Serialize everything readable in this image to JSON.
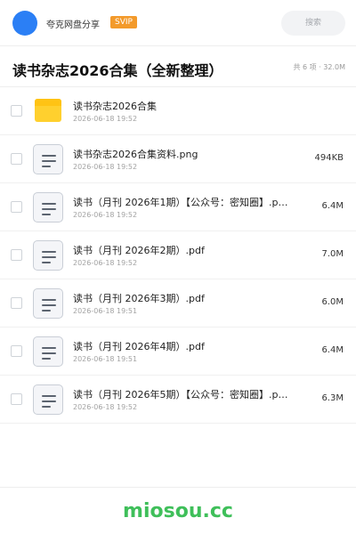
{
  "header": {
    "share_name": "夸克网盘分享",
    "badge": "SVIP",
    "search_placeholder": "搜索",
    "accent_color": "#2b7ff5",
    "badge_color": "#f39a2b"
  },
  "folder": {
    "title": "读书杂志2026合集（全新整理）",
    "summary": "共 6 项 · 32.0M"
  },
  "files": [
    {
      "icon": "folder-icon",
      "name": "读书杂志2026合集",
      "date": "2026-06-18 19:52",
      "size": ""
    },
    {
      "icon": "document-icon",
      "name": "读书杂志2026合集资料.png",
      "date": "2026-06-18 19:52",
      "size": "494KB"
    },
    {
      "icon": "document-icon",
      "name": "读书（月刊 2026年1期）【公众号：密知圈】.p…",
      "date": "2026-06-18 19:52",
      "size": "6.4M"
    },
    {
      "icon": "document-icon",
      "name": "读书（月刊 2026年2期）.pdf",
      "date": "2026-06-18 19:52",
      "size": "7.0M"
    },
    {
      "icon": "document-icon",
      "name": "读书（月刊 2026年3期）.pdf",
      "date": "2026-06-18 19:51",
      "size": "6.0M"
    },
    {
      "icon": "document-icon",
      "name": "读书（月刊 2026年4期）.pdf",
      "date": "2026-06-18 19:51",
      "size": "6.4M"
    },
    {
      "icon": "document-icon",
      "name": "读书（月刊 2026年5期）【公众号：密知圈】.p…",
      "date": "2026-06-18 19:52",
      "size": "6.3M"
    }
  ],
  "footer": {
    "watermark": "miosou.cc",
    "watermark_color": "#3fbf5a"
  }
}
